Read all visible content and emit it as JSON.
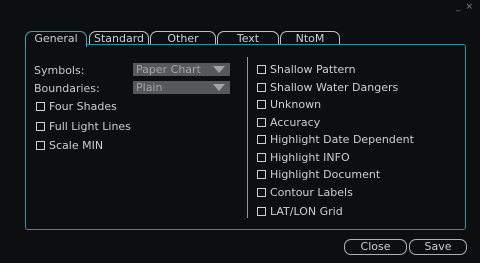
{
  "window": {
    "controls": "_ ×"
  },
  "tabs": [
    {
      "label": "General",
      "active": true
    },
    {
      "label": "Standard",
      "active": false
    },
    {
      "label": "Other",
      "active": false
    },
    {
      "label": "Text",
      "active": false
    },
    {
      "label": "NtoM",
      "active": false
    }
  ],
  "general": {
    "symbols_label": "Symbols:",
    "symbols_value": "Paper Chart",
    "boundaries_label": "Boundaries:",
    "boundaries_value": "Plain",
    "left_checks": [
      {
        "label": "Four Shades",
        "checked": false
      },
      {
        "label": "Full Light Lines",
        "checked": false
      },
      {
        "label": "Scale MIN",
        "checked": false
      }
    ],
    "right_checks": [
      {
        "label": "Shallow Pattern",
        "checked": false
      },
      {
        "label": "Shallow Water Dangers",
        "checked": false
      },
      {
        "label": "Unknown",
        "checked": false
      },
      {
        "label": "Accuracy",
        "checked": false
      },
      {
        "label": "Highlight Date Dependent",
        "checked": false
      },
      {
        "label": "Highlight INFO",
        "checked": false
      },
      {
        "label": "Highlight Document",
        "checked": false
      },
      {
        "label": "Contour Labels",
        "checked": false
      },
      {
        "label": "LAT/LON Grid",
        "checked": false
      }
    ]
  },
  "buttons": {
    "close": "Close",
    "save": "Save"
  },
  "colors": {
    "background": "#0c0e10",
    "accent": "#2c93a3",
    "dropdown_bg": "#55595b"
  }
}
